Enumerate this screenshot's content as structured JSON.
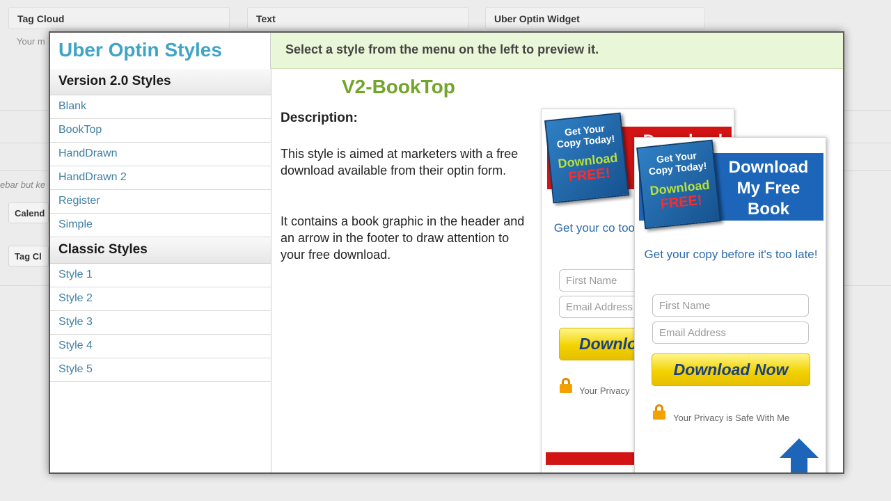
{
  "background": {
    "widgets": [
      "Tag Cloud",
      "Text",
      "Uber Optin Widget"
    ],
    "fragment_1": "Your m",
    "fragment_2": "ebar but ke",
    "button_1": "Calend",
    "button_2": "Tag Cl"
  },
  "modal": {
    "title": "Uber Optin Styles",
    "hint": "Select a style from the menu on the left to preview it.",
    "groups": [
      {
        "heading": "Version 2.0 Styles",
        "items": [
          "Blank",
          "BookTop",
          "HandDrawn",
          "HandDrawn 2",
          "Register",
          "Simple"
        ]
      },
      {
        "heading": "Classic Styles",
        "items": [
          "Style 1",
          "Style 2",
          "Style 3",
          "Style 4",
          "Style 5"
        ]
      }
    ],
    "selected_style": "V2-BookTop",
    "description_label": "Description:",
    "description_1": "This style is aimed at marketers with a free download available from their optin form.",
    "description_2": "It contains a book graphic in the header and an arrow in the footer to draw attention to your free download."
  },
  "preview": {
    "book_line1": "Get Your Copy Today!",
    "book_line2": "Download",
    "book_line3": "FREE!",
    "back_banner_title": "Download",
    "back_tagline": "Get your co too",
    "back_first_name": "First Name",
    "back_email": "Email Address",
    "back_button": "Downlo",
    "back_privacy": "Your Privacy",
    "front_banner_title": "Download My Free Book",
    "front_tagline": "Get your copy before it's too late!",
    "front_first_name": "First Name",
    "front_email": "Email Address",
    "front_button": "Download Now",
    "front_privacy": "Your Privacy is Safe With Me"
  },
  "colors": {
    "title_blue": "#3fa5c6",
    "style_green": "#72a529",
    "link_blue": "#3f7fa3",
    "banner_red": "#d21414",
    "banner_blue": "#1c65b9",
    "button_yellow": "#f2d300"
  },
  "icons": [
    "lock-icon",
    "up-arrow-icon",
    "book-graphic"
  ]
}
